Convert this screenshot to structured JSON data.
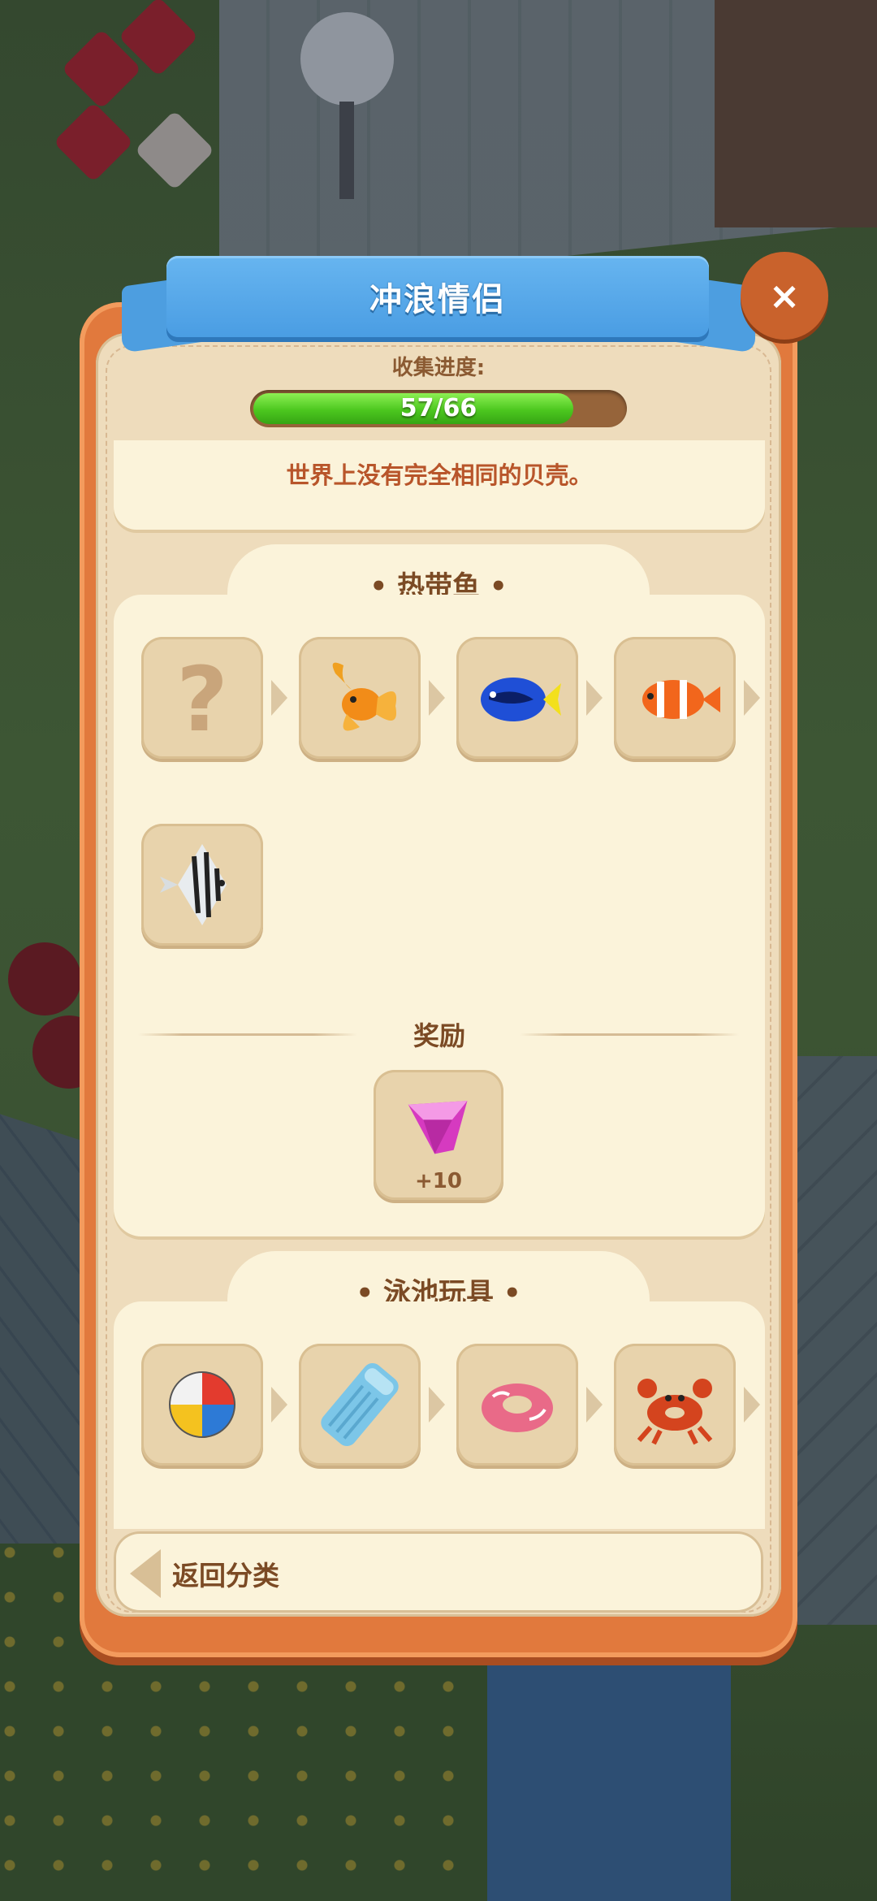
{
  "modal": {
    "title": "冲浪情侣",
    "close_icon": "×"
  },
  "progress": {
    "label": "收集进度:",
    "current": 57,
    "total": 66,
    "text": "57/66",
    "fill_color": "#4cc71f"
  },
  "description": "世界上没有完全相同的贝壳。",
  "sections": [
    {
      "title": "•  热带鱼  •",
      "items": [
        {
          "icon": "question-mark-icon",
          "unlocked": false
        },
        {
          "icon": "goldfish-icon",
          "unlocked": true
        },
        {
          "icon": "blue-tang-fish-icon",
          "unlocked": true
        },
        {
          "icon": "clownfish-icon",
          "unlocked": true
        },
        {
          "icon": "angelfish-icon",
          "unlocked": true
        }
      ],
      "reward": {
        "label": "奖励",
        "icon": "pink-gem-icon",
        "amount": "+10"
      }
    },
    {
      "title": "•  泳池玩具  •",
      "items": [
        {
          "icon": "beach-ball-icon"
        },
        {
          "icon": "pool-float-mattress-icon"
        },
        {
          "icon": "swim-ring-icon"
        },
        {
          "icon": "crab-float-icon"
        }
      ]
    }
  ],
  "back_button": {
    "label": "返回分类",
    "icon": "back-arrow-icon"
  },
  "colors": {
    "panel_orange": "#e1793d",
    "ribbon_blue": "#4a9de3",
    "cream": "#fbf3da",
    "text_brown": "#7b4a24",
    "accent_red": "#b8552a"
  }
}
